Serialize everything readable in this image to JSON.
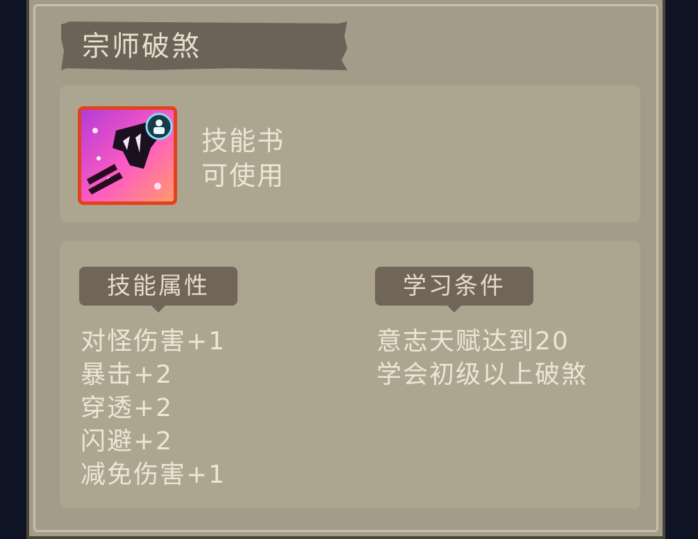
{
  "title": "宗师破煞",
  "item": {
    "icon": "skill-book-icon",
    "type_label": "技能书",
    "usable_label": "可使用"
  },
  "attributes": {
    "header": "技能属性",
    "items": [
      "对怪伤害+1",
      "暴击+2",
      "穿透+2",
      "闪避+2",
      "减免伤害+1"
    ]
  },
  "requirements": {
    "header": "学习条件",
    "items": [
      "意志天赋达到20",
      "学会初级以上破煞"
    ]
  },
  "colors": {
    "panel": "#a39c88",
    "banner": "#6d6258",
    "text": "#ece6d5",
    "icon_border": "#e0421c"
  }
}
